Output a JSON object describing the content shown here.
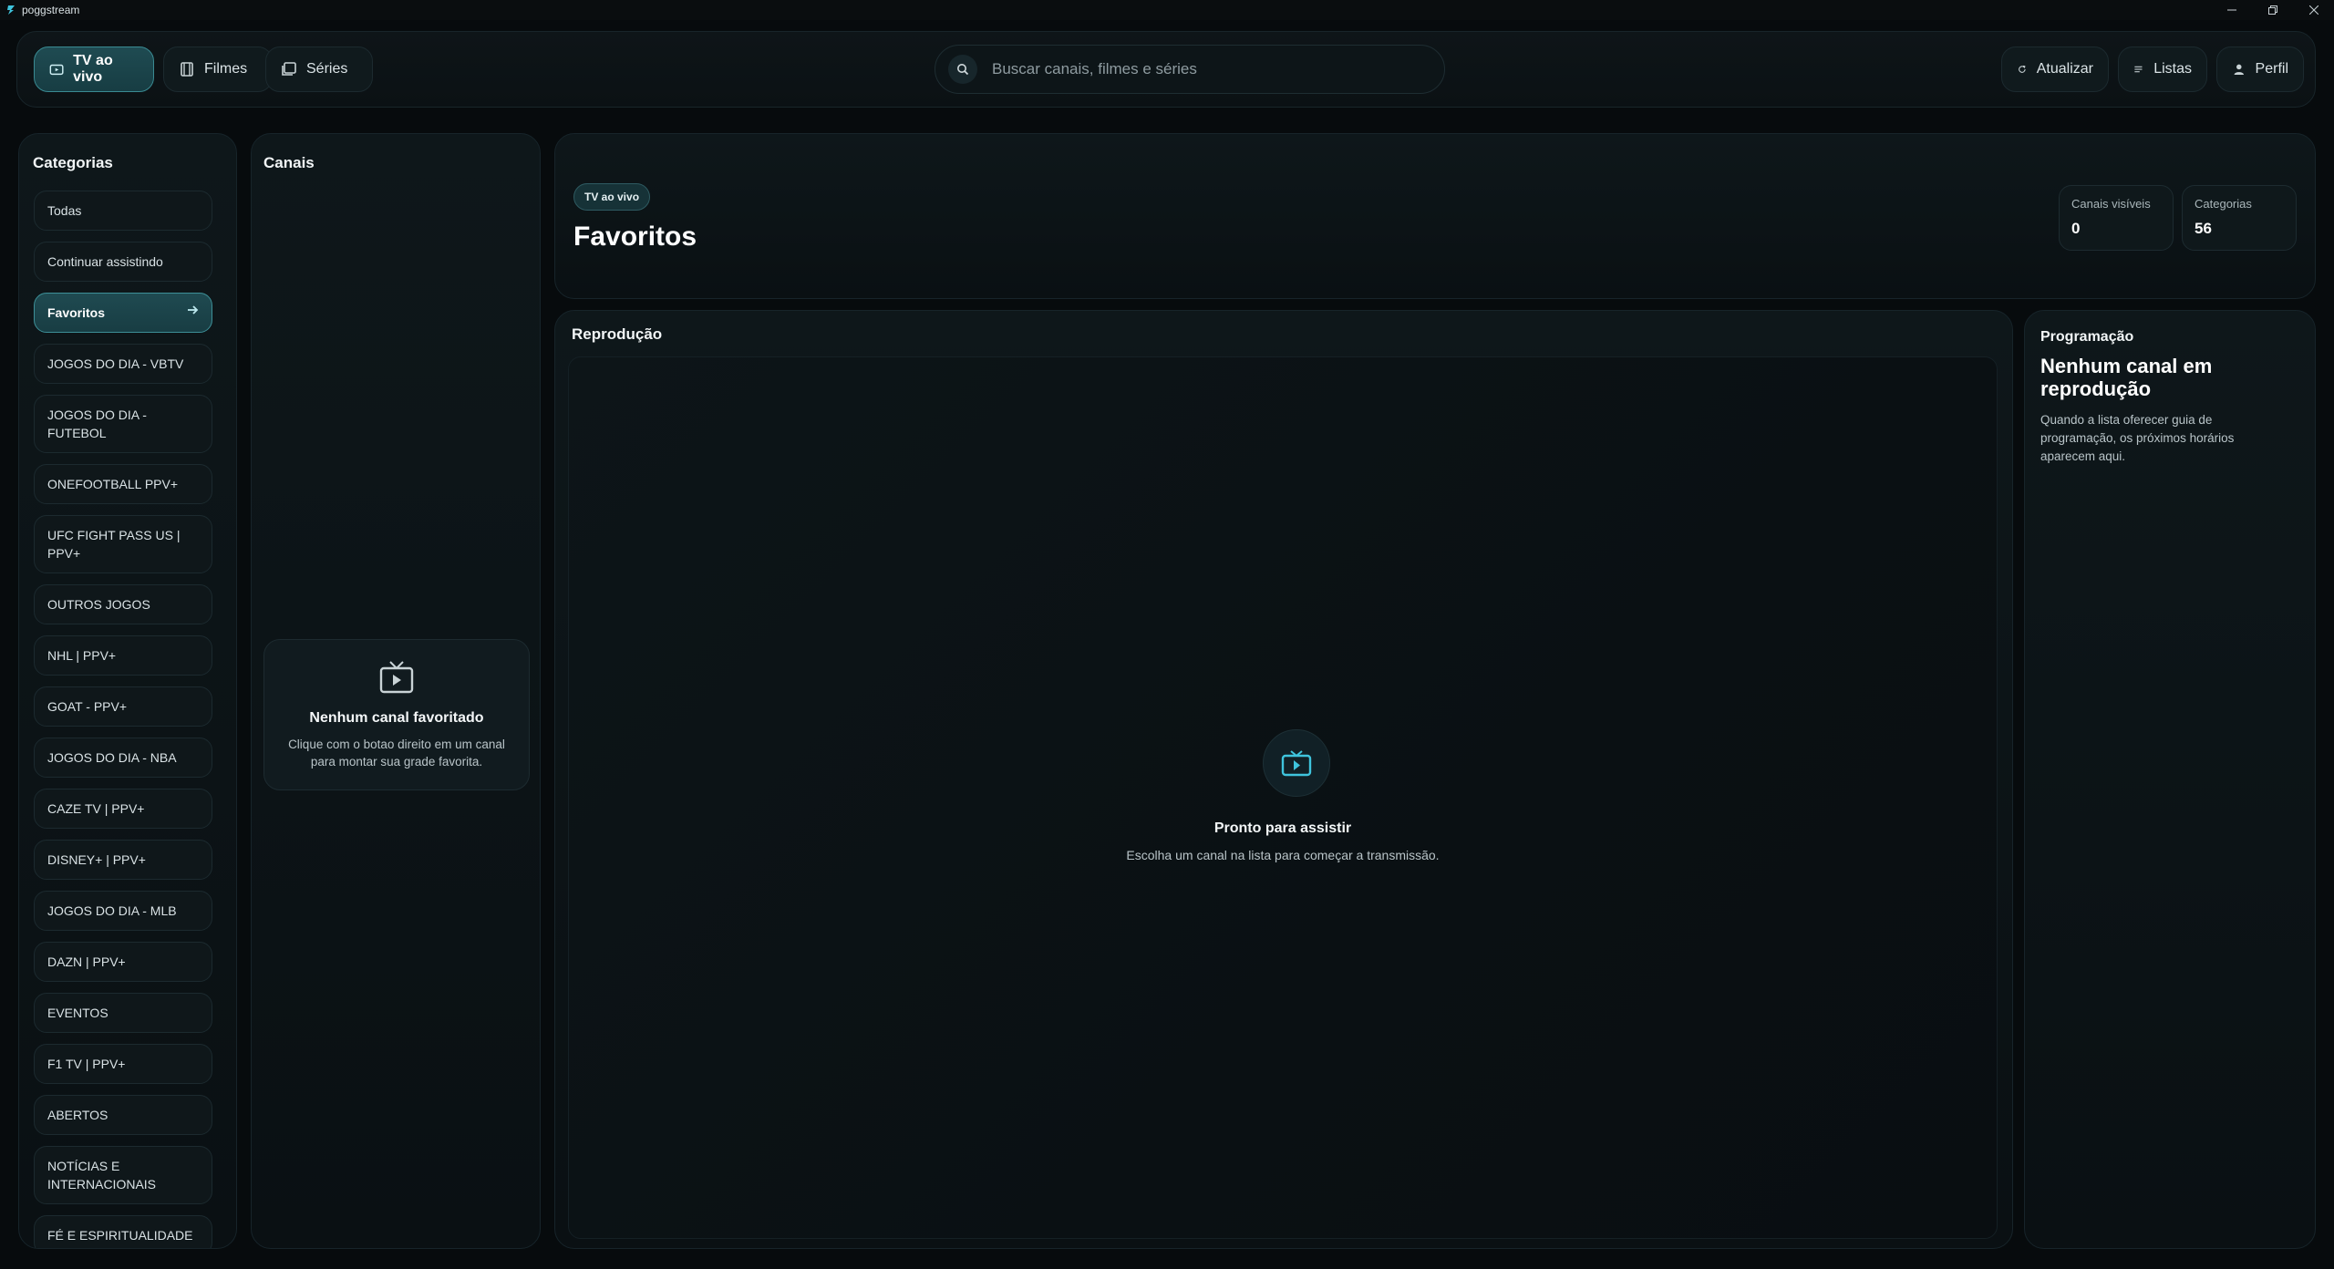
{
  "window": {
    "title": "poggstream",
    "controls": [
      "minimize",
      "restore",
      "close"
    ]
  },
  "nav": {
    "tabs": [
      {
        "label": "TV ao vivo",
        "icon": "tv-icon",
        "active": true
      },
      {
        "label": "Filmes",
        "icon": "film-icon",
        "active": false
      },
      {
        "label": "Séries",
        "icon": "series-icon",
        "active": false
      }
    ],
    "search_placeholder": "Buscar canais, filmes e séries",
    "actions": [
      {
        "label": "Atualizar",
        "icon": "refresh-icon"
      },
      {
        "label": "Listas",
        "icon": "list-icon"
      },
      {
        "label": "Perfil",
        "icon": "user-icon"
      }
    ]
  },
  "categories": {
    "title": "Categorias",
    "items": [
      {
        "label": "Todas",
        "active": false
      },
      {
        "label": "Continuar assistindo",
        "active": false
      },
      {
        "label": "Favoritos",
        "active": true
      },
      {
        "label": "JOGOS DO DIA - VBTV",
        "active": false
      },
      {
        "label": "JOGOS DO DIA - FUTEBOL",
        "active": false
      },
      {
        "label": "ONEFOOTBALL PPV+",
        "active": false
      },
      {
        "label": "UFC FIGHT PASS US | PPV+",
        "active": false
      },
      {
        "label": "OUTROS JOGOS",
        "active": false
      },
      {
        "label": "NHL | PPV+",
        "active": false
      },
      {
        "label": "GOAT - PPV+",
        "active": false
      },
      {
        "label": "JOGOS DO DIA - NBA",
        "active": false
      },
      {
        "label": "CAZE TV | PPV+",
        "active": false
      },
      {
        "label": "DISNEY+ | PPV+",
        "active": false
      },
      {
        "label": "JOGOS DO DIA - MLB",
        "active": false
      },
      {
        "label": "DAZN | PPV+",
        "active": false
      },
      {
        "label": "EVENTOS",
        "active": false
      },
      {
        "label": "F1 TV | PPV+",
        "active": false
      },
      {
        "label": "ABERTOS",
        "active": false
      },
      {
        "label": "NOTÍCIAS E INTERNACIONAIS",
        "active": false
      },
      {
        "label": "FÉ E ESPIRITUALIDADE",
        "active": false
      }
    ]
  },
  "channels": {
    "title": "Canais",
    "empty_title": "Nenhum canal favoritado",
    "empty_desc": "Clique com o botao direito em um canal para montar sua grade favorita."
  },
  "hero": {
    "badge": "TV ao vivo",
    "title": "Favoritos",
    "stats": [
      {
        "label": "Canais visíveis",
        "value": "0"
      },
      {
        "label": "Categorias",
        "value": "56"
      }
    ]
  },
  "player": {
    "title": "Reprodução",
    "empty_title": "Pronto para assistir",
    "empty_desc": "Escolha um canal na lista para começar a transmissão."
  },
  "programming": {
    "title": "Programação",
    "headline": "Nenhum canal em reprodução",
    "desc": "Quando a lista oferecer guia de programação, os próximos horários aparecem aqui."
  },
  "colors": {
    "background": "#070b0d",
    "accent": "#3a8a92",
    "accent_icon": "#3fc4dd"
  }
}
